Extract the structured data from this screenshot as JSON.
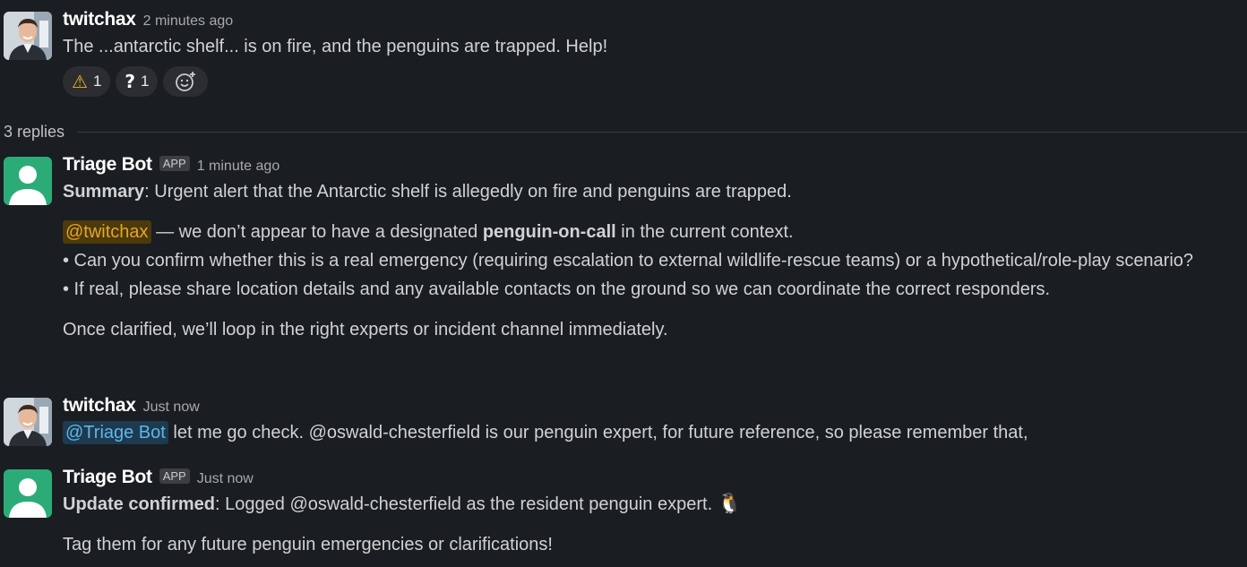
{
  "messages": [
    {
      "author": "twitchax",
      "timestamp": "2 minutes ago",
      "text": "The ...antarctic shelf... is on fire, and the penguins are trapped.  Help!",
      "reactions": [
        {
          "emoji": "⚠",
          "count": "1",
          "icon": "warning-icon"
        },
        {
          "emoji": "?",
          "count": "1",
          "icon": "question-mark-icon"
        }
      ]
    },
    {
      "author": "Triage Bot",
      "badge": "APP",
      "timestamp": "1 minute ago",
      "summary_label": "Summary",
      "summary_text": ": Urgent alert that the Antarctic shelf is allegedly on fire and penguins are trapped.",
      "mention": "@twitchax",
      "line2_pre": " — we don’t appear to have a designated ",
      "line2_bold": "penguin-on-call",
      "line2_post": " in the current context.",
      "bullet1": "• Can you confirm whether this is a real emergency (requiring escalation to external wildlife-rescue teams) or a hypothetical/role-play scenario?",
      "bullet2": "• If real, please share location details and any available contacts on the ground so we can coordinate the correct responders.",
      "closing": "Once clarified, we’ll loop in the right experts or incident channel immediately."
    },
    {
      "author": "twitchax",
      "timestamp": "Just now",
      "mention": "@Triage Bot",
      "text": " let me go check.  @oswald-chesterfield is our penguin expert, for future reference, so please remember that,"
    },
    {
      "author": "Triage Bot",
      "badge": "APP",
      "timestamp": "Just now",
      "label": "Update confirmed",
      "text": ": Logged @oswald-chesterfield as the resident penguin expert. ",
      "emoji": "🐧",
      "line2": "Tag them for any future penguin emergencies or clarifications!"
    }
  ],
  "thread": {
    "replies_label": "3 replies"
  },
  "colors": {
    "background": "#1a1d21",
    "mention_user": "#e8a427",
    "mention_bot": "#5fb6e8",
    "bot_avatar": "#2bac76"
  }
}
